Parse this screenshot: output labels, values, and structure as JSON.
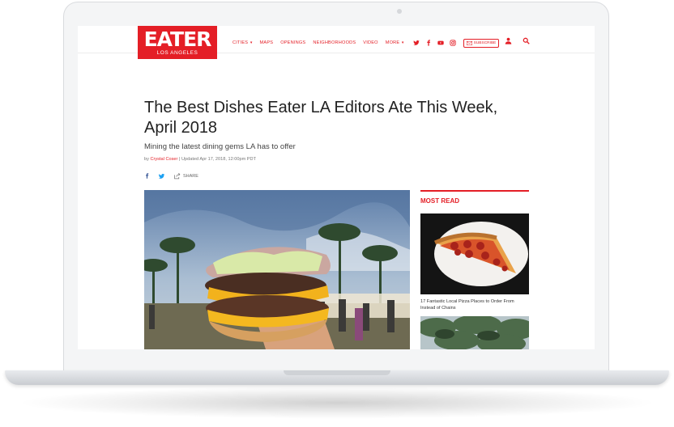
{
  "logo": {
    "word": "EATER",
    "city": "LOS ANGELES"
  },
  "nav": {
    "items": [
      "CITIES",
      "MAPS",
      "OPENINGS",
      "NEIGHBORHOODS",
      "VIDEO",
      "MORE"
    ],
    "subscribe": "SUBSCRIBE"
  },
  "article": {
    "headline": "The Best Dishes Eater LA Editors Ate This Week, April 2018",
    "dek": "Mining the latest dining gems LA has to offer",
    "by_prefix": "by",
    "author": "Crystal Coser",
    "updated": "Updated Apr 17, 2018, 12:00pm PDT",
    "share_label": "SHARE"
  },
  "sidebar": {
    "title": "MOST READ",
    "items": [
      {
        "caption": "17 Fantastic Local Pizza Places to Order From Instead of Chains"
      }
    ]
  },
  "colors": {
    "brand": "#e41e26"
  },
  "icons": [
    "twitter-icon",
    "facebook-icon",
    "youtube-icon",
    "instagram-icon",
    "mail-icon",
    "user-icon",
    "search-icon"
  ]
}
